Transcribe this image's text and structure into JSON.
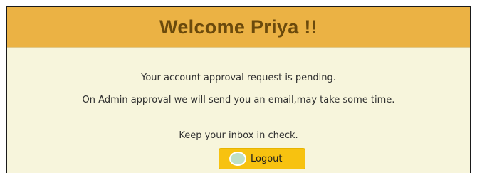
{
  "header": {
    "title": "Welcome Priya !!"
  },
  "message": {
    "line1": "Your account approval request is pending.",
    "line2": "On Admin approval we will send you an email,may take some time.",
    "line3": "Keep your inbox in check."
  },
  "actions": {
    "logout_label": "Logout",
    "logout_icon": "logout-circle-icon"
  },
  "colors": {
    "header_bg": "#ebb244",
    "title_text": "#6b4a0c",
    "panel_bg": "#f7f5dc",
    "button_bg": "#f7c210"
  }
}
